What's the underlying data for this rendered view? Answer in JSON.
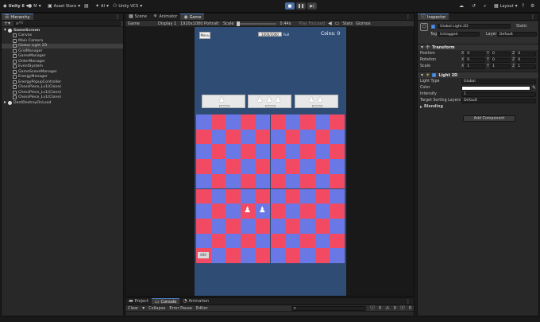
{
  "toolbar": {
    "account": "Unity 6",
    "user": "M",
    "asset_store": "Asset Store",
    "ai": "AI",
    "vcs": "Unity VCS",
    "layout": "Layout"
  },
  "hierarchy": {
    "tab": "Hierarchy",
    "search_placeholder": "All",
    "scene": "GameScreen",
    "items": [
      "Canvas",
      "Main Camera",
      "Global Light 2D",
      "GridManager",
      "GameManager",
      "OrderManager",
      "EventSystem",
      "GameSceneManager",
      "EnergyManager",
      "EnergyPopupController",
      "ChessPiece_Lv1(Clone)",
      "ChessPiece_Lv1(Clone)",
      "ChessPiece_Lv1(Clone)"
    ],
    "dont_destroy": "DontDestroyOnLoad"
  },
  "scene_tabs": {
    "scene": "Scene",
    "animator": "Animator",
    "game": "Game"
  },
  "game_bar": {
    "display_mode": "Game",
    "display": "Display 1",
    "resolution": "1920x1080 Portrait",
    "scale_label": "Scale",
    "scale_value": "0.44x",
    "play_focused": "Play Focused",
    "stats": "Stats",
    "gizmos": "Gizmos"
  },
  "game": {
    "menu_button": "Menu",
    "energy_text": "1000/1000",
    "energy_suffix": "Full",
    "coins_label": "Coins: 0",
    "board_corner_label": "888"
  },
  "bottom_tabs": {
    "project": "Project",
    "console": "Console",
    "animation": "Animation",
    "clear": "Clear",
    "collapse": "Collapse",
    "error_pause": "Error Pause",
    "editor": "Editor",
    "count_log": "0",
    "count_warn": "0",
    "count_err": "0"
  },
  "inspector": {
    "tab": "Inspector",
    "object_name": "Global Light 2D",
    "static_label": "Static",
    "tag_label": "Tag",
    "tag_value": "Untagged",
    "layer_label": "Layer",
    "layer_value": "Default",
    "transform_header": "Transform",
    "position_label": "Position",
    "rotation_label": "Rotation",
    "scale_label": "Scale",
    "position": {
      "x": "0",
      "y": "0",
      "z": "0"
    },
    "rotation": {
      "x": "0",
      "y": "0",
      "z": "0"
    },
    "scale": {
      "x": "1",
      "y": "1",
      "z": "1"
    },
    "light_header": "Light 2D",
    "light_type_label": "Light Type",
    "light_type_value": "Global",
    "color_label": "Color",
    "intensity_label": "Intensity",
    "intensity_value": "1",
    "sorting_label": "Target Sorting Layers",
    "sorting_value": "Default",
    "blending_label": "Blending",
    "add_component": "Add Component"
  },
  "colors": {
    "board_red": "#f24a63",
    "board_blue": "#6a78e6",
    "device_bg": "#2e4c74",
    "accent": "#4a6ea3"
  }
}
